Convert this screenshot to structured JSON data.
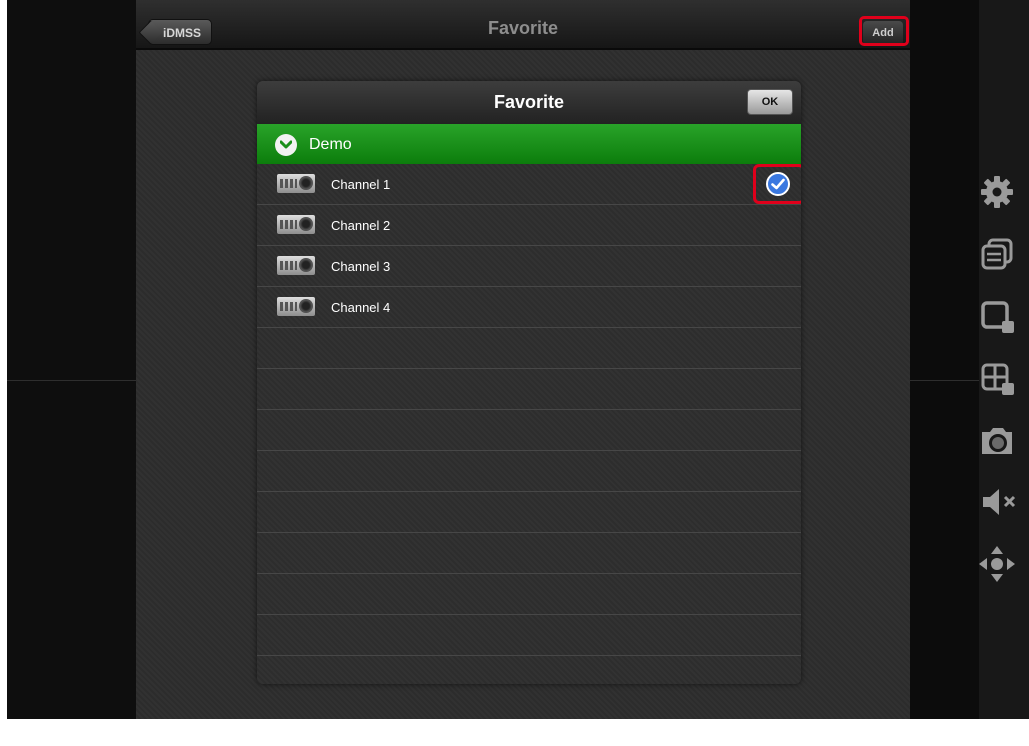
{
  "nav": {
    "title": "Favorite",
    "back_label": "iDMSS",
    "add_label": "Add"
  },
  "dialog": {
    "title": "Favorite",
    "ok_label": "OK",
    "group": {
      "name": "Demo",
      "icon": "chevron-down-icon"
    },
    "channels": [
      {
        "label": "Channel 1",
        "checked": true
      },
      {
        "label": "Channel 2",
        "checked": false
      },
      {
        "label": "Channel 3",
        "checked": false
      },
      {
        "label": "Channel 4",
        "checked": false
      }
    ]
  },
  "side_toolbar": [
    "gear-icon",
    "window-switch-icon",
    "single-window-icon",
    "split-layout-icon",
    "camera-snapshot-icon",
    "mute-icon",
    "ptz-arrows-icon"
  ],
  "colors": {
    "group_green": "#1a8f1a",
    "highlight_red": "#e0001b",
    "check_blue": "#3a78e0"
  }
}
